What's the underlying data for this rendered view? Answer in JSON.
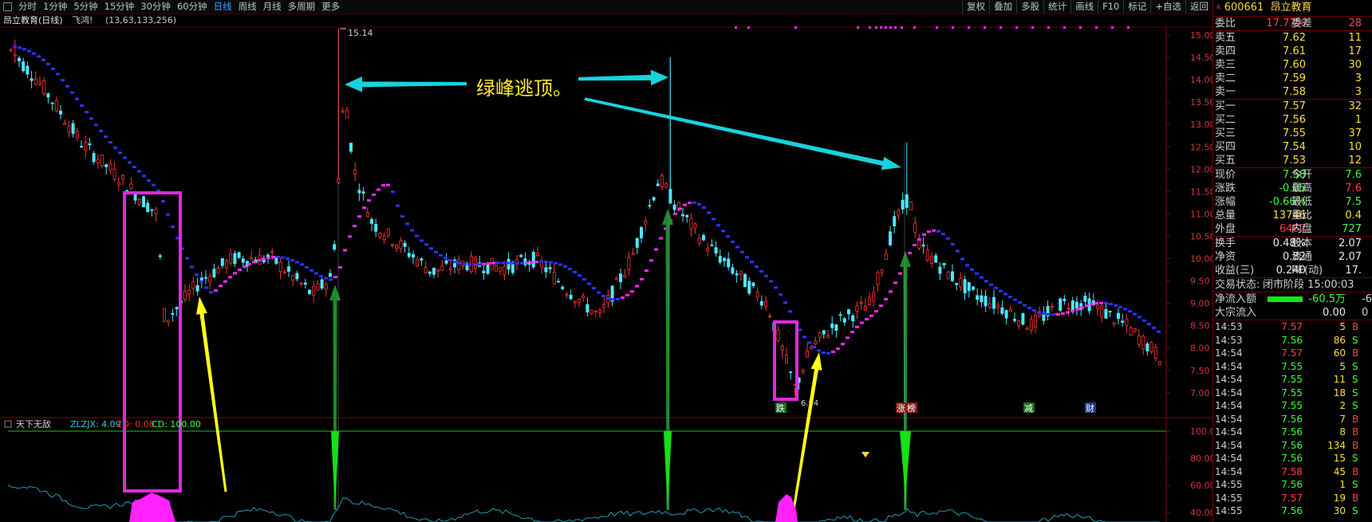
{
  "toolbar": {
    "periods": [
      "分时",
      "1分钟",
      "5分钟",
      "15分钟",
      "30分钟",
      "60分钟",
      "日线",
      "周线",
      "月线",
      "多周期",
      "更多"
    ],
    "active_period": "日线",
    "tools": [
      "复权",
      "叠加",
      "多股",
      "统计",
      "画线",
      "F10",
      "标记",
      "+自选",
      "返回"
    ]
  },
  "chart_header": {
    "title": "昂立教育(日线)",
    "indicator": "飞鸿!",
    "params": "(13,63,133,256)"
  },
  "annotation": {
    "text": "绿峰逃顶。",
    "high_label": "15.14",
    "low_label": "6.94",
    "badges": [
      "跌",
      "涨",
      "榜",
      "减",
      "财"
    ]
  },
  "sub_header": {
    "name": "天下无敌",
    "zlzjx": "ZLZJX: 4.09",
    "zd": "ZD: 0.08",
    "cd": "CD: 100.00"
  },
  "price_axis": [
    "15.00",
    "14.50",
    "14.00",
    "13.50",
    "13.00",
    "12.50",
    "12.00",
    "11.50",
    "11.00",
    "10.50",
    "10.00",
    "9.50",
    "9.00",
    "8.50",
    "8.00",
    "7.50",
    "7.00"
  ],
  "sub_axis": [
    "100.0",
    "80.00",
    "60.00",
    "40.00"
  ],
  "colors": {
    "up": "#ff3333",
    "down": "#4ee6ff",
    "ma_blue": "#2a35ff",
    "ma_magenta": "#ff2aff",
    "arrow_cyan": "#19d2dc",
    "arrow_yellow": "#ffff19",
    "arrow_green": "#1f8a2a",
    "box": "#e128e1"
  },
  "quote": {
    "code": "600661",
    "name": "昂立教育",
    "weibi_label": "委比",
    "weibi": "17.77%",
    "weicha_label": "委差",
    "weicha": "28",
    "asks": [
      {
        "label": "卖五",
        "price": "7.62",
        "vol": "11"
      },
      {
        "label": "卖四",
        "price": "7.61",
        "vol": "17"
      },
      {
        "label": "卖三",
        "price": "7.60",
        "vol": "30"
      },
      {
        "label": "卖二",
        "price": "7.59",
        "vol": "3"
      },
      {
        "label": "卖一",
        "price": "7.58",
        "vol": "3"
      }
    ],
    "bids": [
      {
        "label": "买一",
        "price": "7.57",
        "vol": "32"
      },
      {
        "label": "买二",
        "price": "7.56",
        "vol": "1"
      },
      {
        "label": "买三",
        "price": "7.55",
        "vol": "37"
      },
      {
        "label": "买四",
        "price": "7.54",
        "vol": "10"
      },
      {
        "label": "买五",
        "price": "7.53",
        "vol": "12"
      }
    ],
    "stats1": [
      {
        "l": "现价",
        "v": "7.58",
        "c": "green",
        "l2": "今开",
        "v2": "7.6",
        "c2": "green"
      },
      {
        "l": "涨跌",
        "v": "-0.05",
        "c": "green",
        "l2": "最高",
        "v2": "7.6",
        "c2": "red"
      },
      {
        "l": "涨幅",
        "v": "-0.66%",
        "c": "green",
        "l2": "最低",
        "v2": "7.5",
        "c2": "green"
      },
      {
        "l": "总量",
        "v": "13746",
        "c": "yellow",
        "l2": "量比",
        "v2": "0.4",
        "c2": "yellow"
      },
      {
        "l": "外盘",
        "v": "6467",
        "c": "red",
        "l2": "内盘",
        "v2": "727",
        "c2": "green"
      }
    ],
    "stats2": [
      {
        "l": "换手",
        "v": "0.48%",
        "c": "white",
        "l2": "股本",
        "v2": "2.07",
        "c2": "white"
      },
      {
        "l": "净资",
        "v": "0.82",
        "c": "white",
        "l2": "流通",
        "v2": "2.07",
        "c2": "white"
      },
      {
        "l": "收益(三)",
        "v": "0.240",
        "c": "white",
        "l2": "PE(动)",
        "v2": "17.",
        "c2": "white"
      }
    ],
    "trade_state_label": "交易状态:",
    "trade_state": "闭市阶段 15:00:03",
    "net_inflow_label": "净流入额",
    "net_inflow": "-60.5万",
    "net_inflow_tail": "-6",
    "big_inflow_label": "大宗流入",
    "big_inflow": "0.00",
    "big_inflow_tail": "0"
  },
  "ticks": [
    {
      "t": "14:53",
      "p": "7.57",
      "q": "5",
      "d": "B"
    },
    {
      "t": "14:53",
      "p": "7.56",
      "q": "86",
      "d": "S"
    },
    {
      "t": "14:54",
      "p": "7.57",
      "q": "60",
      "d": "B"
    },
    {
      "t": "14:54",
      "p": "7.55",
      "q": "5",
      "d": "S"
    },
    {
      "t": "14:54",
      "p": "7.55",
      "q": "11",
      "d": "S"
    },
    {
      "t": "14:54",
      "p": "7.55",
      "q": "18",
      "d": "S"
    },
    {
      "t": "14:54",
      "p": "7.55",
      "q": "2",
      "d": "S"
    },
    {
      "t": "14:54",
      "p": "7.56",
      "q": "7",
      "d": "B"
    },
    {
      "t": "14:54",
      "p": "7.56",
      "q": "8",
      "d": "B"
    },
    {
      "t": "14:54",
      "p": "7.56",
      "q": "134",
      "d": "B"
    },
    {
      "t": "14:54",
      "p": "7.56",
      "q": "15",
      "d": "S"
    },
    {
      "t": "14:54",
      "p": "7.58",
      "q": "45",
      "d": "B"
    },
    {
      "t": "14:55",
      "p": "7.56",
      "q": "1",
      "d": "S"
    },
    {
      "t": "14:55",
      "p": "7.57",
      "q": "19",
      "d": "B"
    },
    {
      "t": "14:55",
      "p": "7.56",
      "q": "30",
      "d": "S"
    }
  ]
}
